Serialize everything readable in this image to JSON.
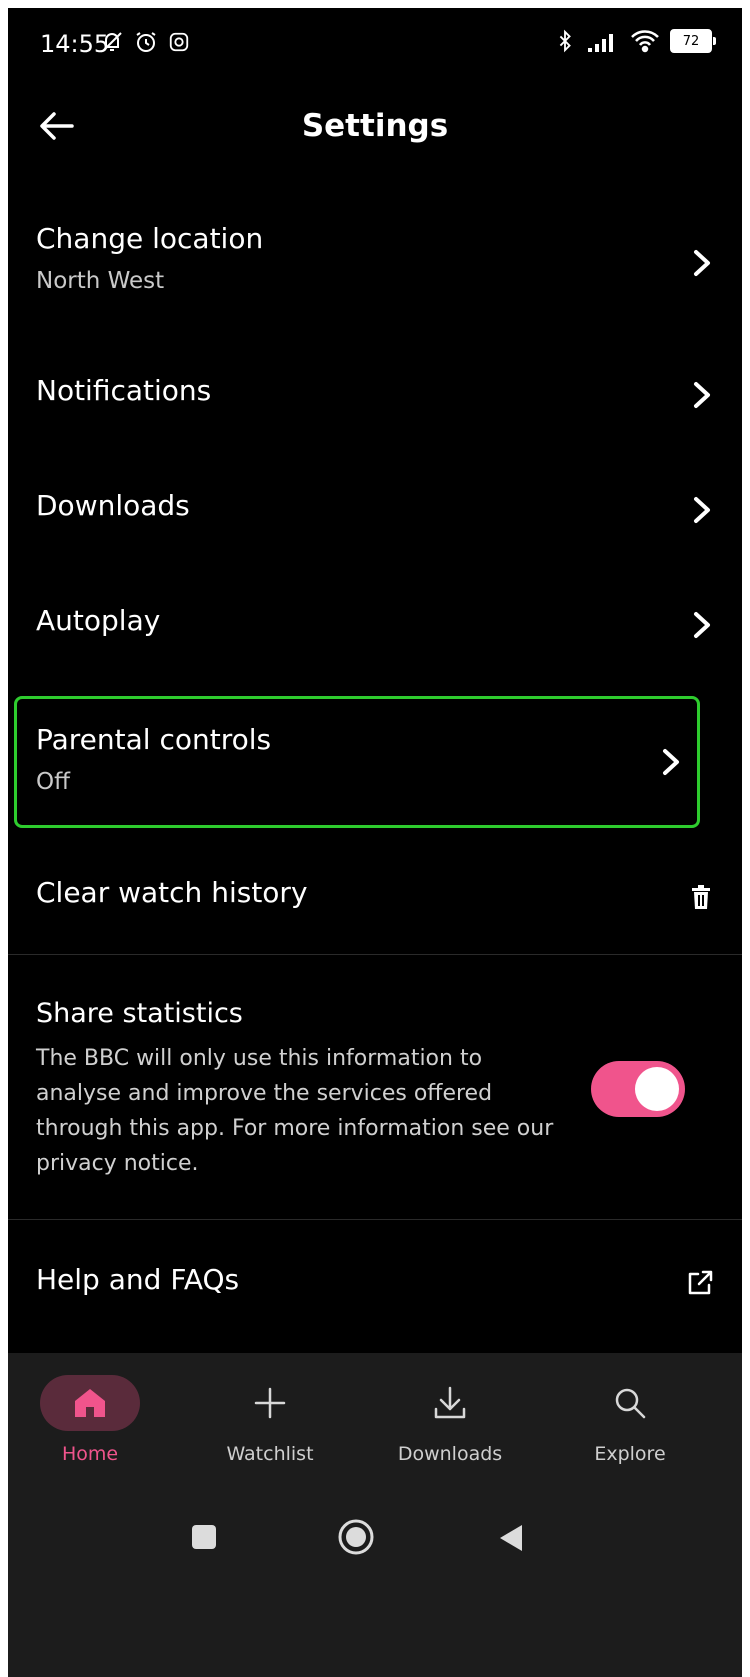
{
  "status_bar": {
    "time": "14:55",
    "battery": "72",
    "icons": [
      "muted-notifications-icon",
      "alarm-icon",
      "instagram-icon",
      "bluetooth-icon",
      "signal-icon",
      "wifi-icon",
      "battery-icon"
    ]
  },
  "header": {
    "title": "Settings",
    "back_icon": "arrow-left-icon"
  },
  "settings": {
    "change_location": {
      "label": "Change location",
      "value": "North West"
    },
    "notifications": {
      "label": "Notifications"
    },
    "downloads": {
      "label": "Downloads"
    },
    "autoplay": {
      "label": "Autoplay"
    },
    "parental_controls": {
      "label": "Parental controls",
      "value": "Off",
      "focused": true
    },
    "clear_watch_history": {
      "label": "Clear watch history",
      "icon": "trash-icon"
    },
    "share_statistics": {
      "label": "Share statistics",
      "description": "The BBC will only use this information to analyse and improve the services offered through this app. For more information see our privacy notice.",
      "enabled": true
    },
    "help": {
      "label": "Help and FAQs",
      "icon": "external-link-icon"
    }
  },
  "bottom_nav": {
    "items": [
      {
        "label": "Home",
        "icon": "home-icon",
        "active": true
      },
      {
        "label": "Watchlist",
        "icon": "plus-icon",
        "active": false
      },
      {
        "label": "Downloads",
        "icon": "download-icon",
        "active": false
      },
      {
        "label": "Explore",
        "icon": "search-icon",
        "active": false
      }
    ]
  },
  "colors": {
    "accent": "#f0548c",
    "focus_border": "#2ecc2e",
    "background": "#000000",
    "nav_background": "#1c1c1c"
  }
}
